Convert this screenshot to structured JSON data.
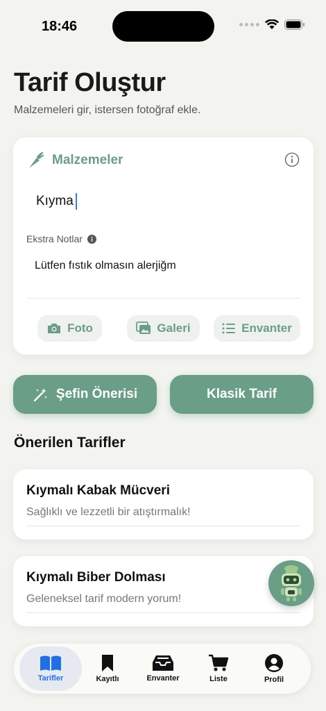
{
  "status": {
    "time": "18:46"
  },
  "header": {
    "title": "Tarif Oluştur",
    "subtitle": "Malzemeleri gir, istersen fotoğraf ekle."
  },
  "ingredients_card": {
    "title": "Malzemeler",
    "input_value": "Kıyma",
    "notes_label": "Ekstra Notlar",
    "notes_value": "Lütfen fıstık olmasın alerjiğm",
    "actions": [
      {
        "label": "Foto",
        "icon": "camera-icon"
      },
      {
        "label": "Galeri",
        "icon": "gallery-icon"
      },
      {
        "label": "Envanter",
        "icon": "list-icon"
      }
    ]
  },
  "buttons": {
    "chef_suggestion": "Şefin Önerisi",
    "classic_recipe": "Klasik Tarif"
  },
  "suggested": {
    "title": "Önerilen Tarifler",
    "items": [
      {
        "name": "Kıymalı Kabak Mücveri",
        "desc": "Sağlıklı ve lezzetli bir atıştırmalık!"
      },
      {
        "name": "Kıymalı Biber Dolması",
        "desc": "Geleneksel tarif modern yorum!"
      }
    ]
  },
  "tabbar": {
    "active": "Tarifler",
    "items": [
      {
        "label": "Tarifler",
        "icon": "book-icon"
      },
      {
        "label": "Kayıtlı",
        "icon": "bookmark-icon"
      },
      {
        "label": "Envanter",
        "icon": "tray-icon"
      },
      {
        "label": "Liste",
        "icon": "cart-icon"
      },
      {
        "label": "Profil",
        "icon": "profile-icon"
      }
    ]
  },
  "colors": {
    "accent": "#6a9e86",
    "active_tab": "#1f6fe5",
    "background": "#f3f4f0"
  }
}
